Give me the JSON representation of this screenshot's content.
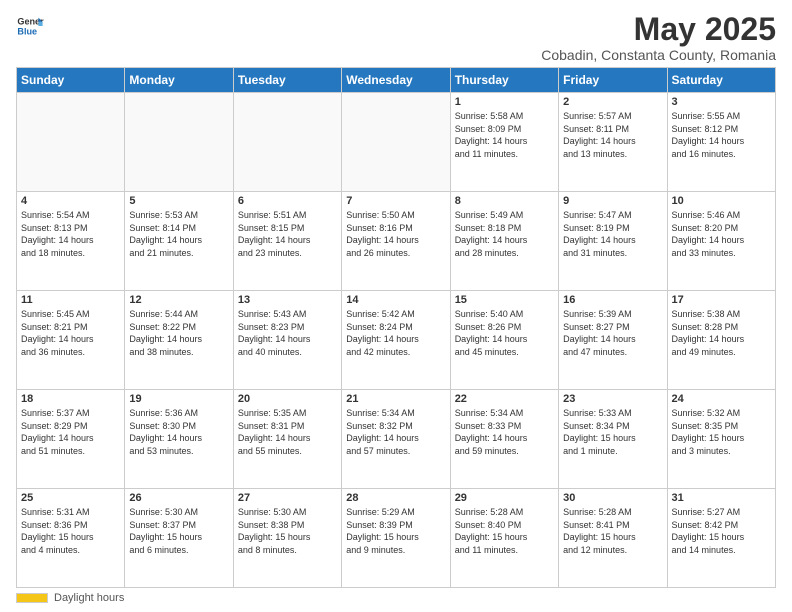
{
  "header": {
    "logo_line1": "General",
    "logo_line2": "Blue",
    "month": "May 2025",
    "location": "Cobadin, Constanta County, Romania"
  },
  "weekdays": [
    "Sunday",
    "Monday",
    "Tuesday",
    "Wednesday",
    "Thursday",
    "Friday",
    "Saturday"
  ],
  "footer": {
    "daylight_label": "Daylight hours"
  },
  "weeks": [
    [
      {
        "day": "",
        "info": ""
      },
      {
        "day": "",
        "info": ""
      },
      {
        "day": "",
        "info": ""
      },
      {
        "day": "",
        "info": ""
      },
      {
        "day": "1",
        "info": "Sunrise: 5:58 AM\nSunset: 8:09 PM\nDaylight: 14 hours\nand 11 minutes."
      },
      {
        "day": "2",
        "info": "Sunrise: 5:57 AM\nSunset: 8:11 PM\nDaylight: 14 hours\nand 13 minutes."
      },
      {
        "day": "3",
        "info": "Sunrise: 5:55 AM\nSunset: 8:12 PM\nDaylight: 14 hours\nand 16 minutes."
      }
    ],
    [
      {
        "day": "4",
        "info": "Sunrise: 5:54 AM\nSunset: 8:13 PM\nDaylight: 14 hours\nand 18 minutes."
      },
      {
        "day": "5",
        "info": "Sunrise: 5:53 AM\nSunset: 8:14 PM\nDaylight: 14 hours\nand 21 minutes."
      },
      {
        "day": "6",
        "info": "Sunrise: 5:51 AM\nSunset: 8:15 PM\nDaylight: 14 hours\nand 23 minutes."
      },
      {
        "day": "7",
        "info": "Sunrise: 5:50 AM\nSunset: 8:16 PM\nDaylight: 14 hours\nand 26 minutes."
      },
      {
        "day": "8",
        "info": "Sunrise: 5:49 AM\nSunset: 8:18 PM\nDaylight: 14 hours\nand 28 minutes."
      },
      {
        "day": "9",
        "info": "Sunrise: 5:47 AM\nSunset: 8:19 PM\nDaylight: 14 hours\nand 31 minutes."
      },
      {
        "day": "10",
        "info": "Sunrise: 5:46 AM\nSunset: 8:20 PM\nDaylight: 14 hours\nand 33 minutes."
      }
    ],
    [
      {
        "day": "11",
        "info": "Sunrise: 5:45 AM\nSunset: 8:21 PM\nDaylight: 14 hours\nand 36 minutes."
      },
      {
        "day": "12",
        "info": "Sunrise: 5:44 AM\nSunset: 8:22 PM\nDaylight: 14 hours\nand 38 minutes."
      },
      {
        "day": "13",
        "info": "Sunrise: 5:43 AM\nSunset: 8:23 PM\nDaylight: 14 hours\nand 40 minutes."
      },
      {
        "day": "14",
        "info": "Sunrise: 5:42 AM\nSunset: 8:24 PM\nDaylight: 14 hours\nand 42 minutes."
      },
      {
        "day": "15",
        "info": "Sunrise: 5:40 AM\nSunset: 8:26 PM\nDaylight: 14 hours\nand 45 minutes."
      },
      {
        "day": "16",
        "info": "Sunrise: 5:39 AM\nSunset: 8:27 PM\nDaylight: 14 hours\nand 47 minutes."
      },
      {
        "day": "17",
        "info": "Sunrise: 5:38 AM\nSunset: 8:28 PM\nDaylight: 14 hours\nand 49 minutes."
      }
    ],
    [
      {
        "day": "18",
        "info": "Sunrise: 5:37 AM\nSunset: 8:29 PM\nDaylight: 14 hours\nand 51 minutes."
      },
      {
        "day": "19",
        "info": "Sunrise: 5:36 AM\nSunset: 8:30 PM\nDaylight: 14 hours\nand 53 minutes."
      },
      {
        "day": "20",
        "info": "Sunrise: 5:35 AM\nSunset: 8:31 PM\nDaylight: 14 hours\nand 55 minutes."
      },
      {
        "day": "21",
        "info": "Sunrise: 5:34 AM\nSunset: 8:32 PM\nDaylight: 14 hours\nand 57 minutes."
      },
      {
        "day": "22",
        "info": "Sunrise: 5:34 AM\nSunset: 8:33 PM\nDaylight: 14 hours\nand 59 minutes."
      },
      {
        "day": "23",
        "info": "Sunrise: 5:33 AM\nSunset: 8:34 PM\nDaylight: 15 hours\nand 1 minute."
      },
      {
        "day": "24",
        "info": "Sunrise: 5:32 AM\nSunset: 8:35 PM\nDaylight: 15 hours\nand 3 minutes."
      }
    ],
    [
      {
        "day": "25",
        "info": "Sunrise: 5:31 AM\nSunset: 8:36 PM\nDaylight: 15 hours\nand 4 minutes."
      },
      {
        "day": "26",
        "info": "Sunrise: 5:30 AM\nSunset: 8:37 PM\nDaylight: 15 hours\nand 6 minutes."
      },
      {
        "day": "27",
        "info": "Sunrise: 5:30 AM\nSunset: 8:38 PM\nDaylight: 15 hours\nand 8 minutes."
      },
      {
        "day": "28",
        "info": "Sunrise: 5:29 AM\nSunset: 8:39 PM\nDaylight: 15 hours\nand 9 minutes."
      },
      {
        "day": "29",
        "info": "Sunrise: 5:28 AM\nSunset: 8:40 PM\nDaylight: 15 hours\nand 11 minutes."
      },
      {
        "day": "30",
        "info": "Sunrise: 5:28 AM\nSunset: 8:41 PM\nDaylight: 15 hours\nand 12 minutes."
      },
      {
        "day": "31",
        "info": "Sunrise: 5:27 AM\nSunset: 8:42 PM\nDaylight: 15 hours\nand 14 minutes."
      }
    ]
  ]
}
